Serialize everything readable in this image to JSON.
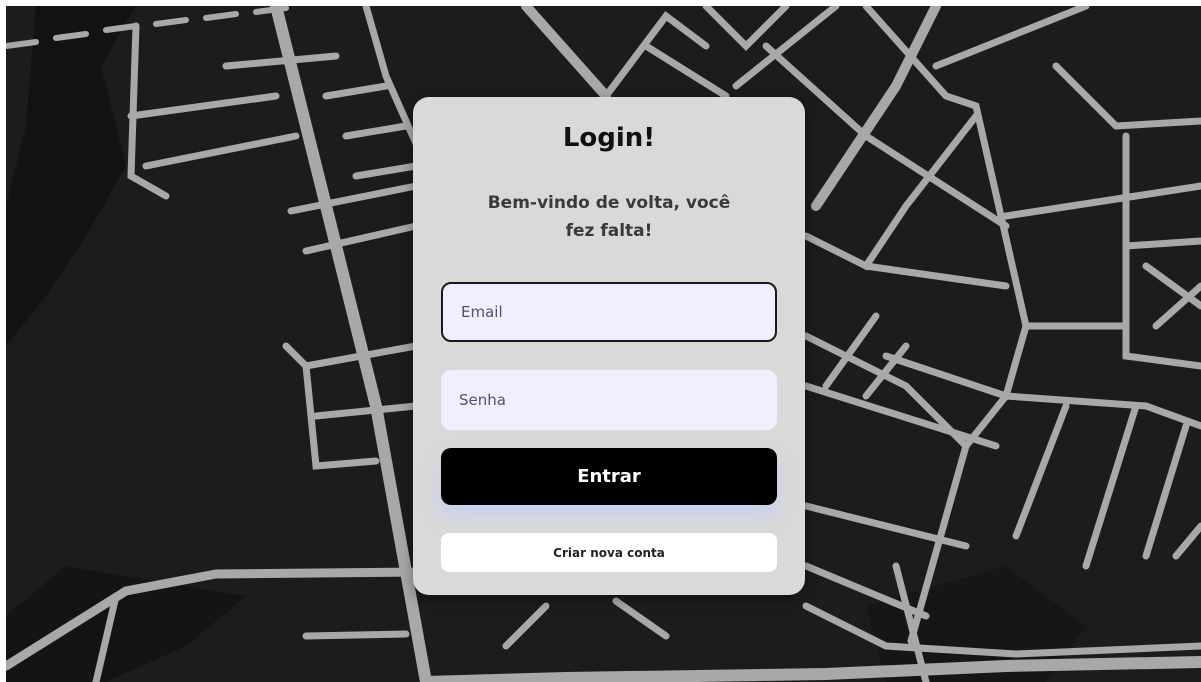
{
  "login": {
    "title": "Login!",
    "subtitle": "Bem-vindo de volta, você fez falta!",
    "email_placeholder": "Email",
    "password_placeholder": "Senha",
    "submit_label": "Entrar",
    "create_account_label": "Criar nova conta"
  },
  "colors": {
    "map_background": "#1c1c1c",
    "map_roads": "#a8a8a8",
    "card_background": "#d9d9d9",
    "input_background": "#f0efff",
    "primary_button": "#000000"
  }
}
